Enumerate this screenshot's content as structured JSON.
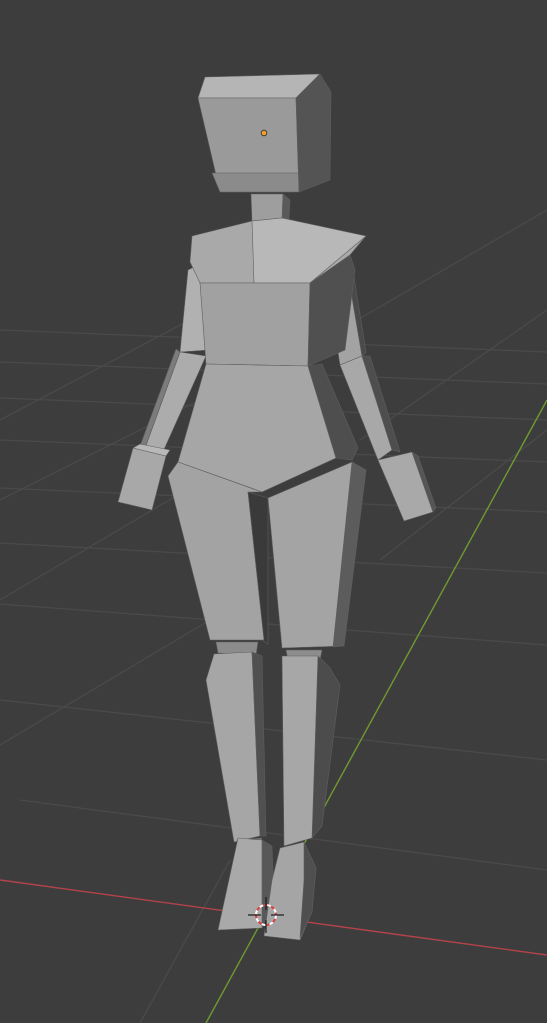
{
  "viewport": {
    "mode": "3d-viewport",
    "background_color": "#3d3d3d",
    "grid_visible": true,
    "grid_color": "#4a4a4a",
    "x_axis_color": "#b3434a",
    "y_axis_color": "#6f9a2f",
    "object_origin_color": "#f0a033",
    "cursor_colors": [
      "#d9413f",
      "#ffffff"
    ],
    "object": {
      "kind": "low-poly humanoid mesh",
      "material_color": "#9b9b9b",
      "selected": false
    }
  }
}
